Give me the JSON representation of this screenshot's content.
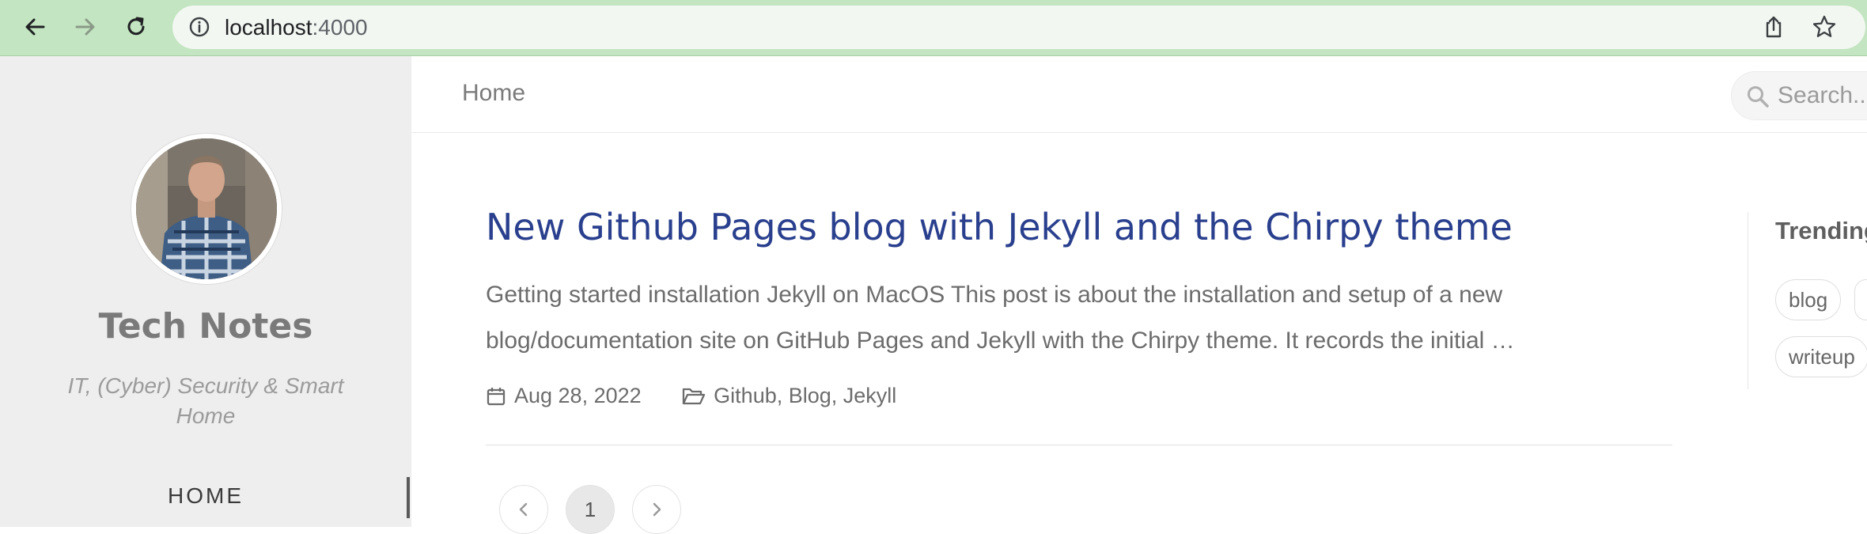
{
  "browser": {
    "url_host": "localhost",
    "url_port": ":4000"
  },
  "sidebar": {
    "title": "Tech Notes",
    "subtitle": "IT, (Cyber) Security & Smart Home",
    "nav": [
      {
        "label": "HOME"
      }
    ]
  },
  "topbar": {
    "breadcrumb": "Home",
    "search_placeholder": "Search..."
  },
  "post": {
    "title": "New Github Pages blog with Jekyll and the Chirpy theme",
    "excerpt": "Getting started installation Jekyll on MacOS This post is about the installation and setup of a new blog/documentation site on GitHub Pages and Jekyll with the Chirpy theme. It records the initial …",
    "date": "Aug 28, 2022",
    "categories": "Github, Blog, Jekyll"
  },
  "pagination": {
    "current": "1"
  },
  "trending": {
    "title": "Trending",
    "tags": [
      "blog",
      "writeup"
    ]
  },
  "colors": {
    "chrome": "#c3e5c1",
    "sidebar_bg": "#eeeeee",
    "link": "#2a408e"
  }
}
